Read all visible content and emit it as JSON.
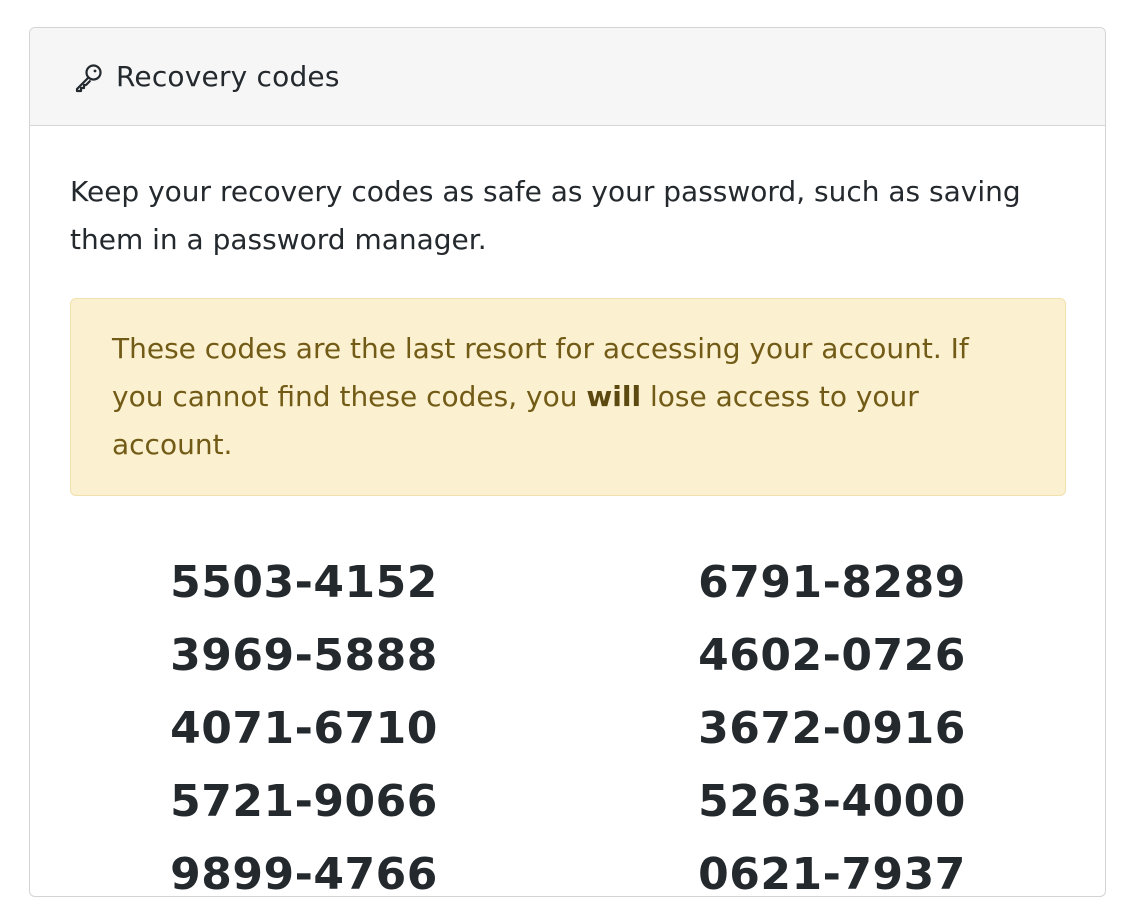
{
  "header": {
    "icon": "key-icon",
    "title": "Recovery codes"
  },
  "intro": "Keep your recovery codes as safe as your password, such as saving them in a password manager.",
  "warning": {
    "before": "These codes are the last resort for accessing your account. If you cannot find these codes, you ",
    "emphasis": "will",
    "after": " lose access to your account."
  },
  "codes": [
    "5503-4152",
    "6791-8289",
    "3969-5888",
    "4602-0726",
    "4071-6710",
    "3672-0916",
    "5721-9066",
    "5263-4000",
    "9899-4766",
    "0621-7937"
  ],
  "colors": {
    "warning_bg": "#fbf0cf",
    "warning_text": "#725b16",
    "header_bg": "#f6f6f6"
  }
}
